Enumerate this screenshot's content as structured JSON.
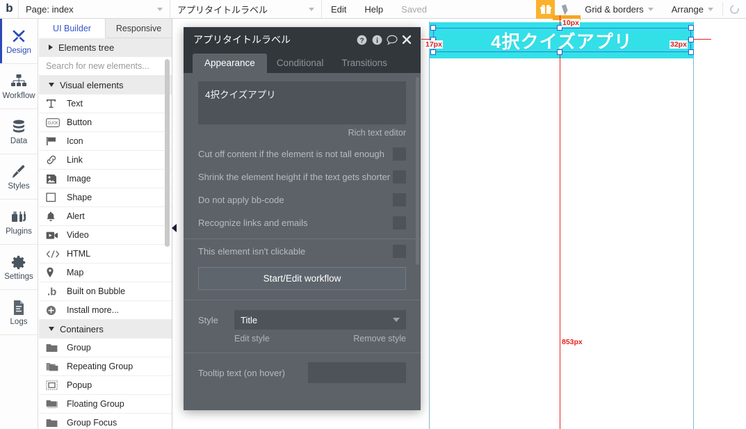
{
  "topbar": {
    "logo": "b",
    "page_selector": {
      "label": "Page: index",
      "icon": "chevron-down-icon"
    },
    "element_selector": {
      "label": "アプリタイトルラベル",
      "icon": "chevron-down-icon"
    },
    "edit": "Edit",
    "help": "Help",
    "saved": "Saved",
    "gift_icon": "gift-icon",
    "cursor_icon": "cursor-arrow-icon",
    "grid_borders": "Grid & borders",
    "arrange": "Arrange",
    "refresh_icon": "refresh-icon"
  },
  "rail": {
    "items": [
      {
        "label": "Design",
        "icon": "design-icon",
        "active": true
      },
      {
        "label": "Workflow",
        "icon": "workflow-icon",
        "active": false
      },
      {
        "label": "Data",
        "icon": "database-icon",
        "active": false
      },
      {
        "label": "Styles",
        "icon": "brush-icon",
        "active": false
      },
      {
        "label": "Plugins",
        "icon": "plugins-icon",
        "active": false
      },
      {
        "label": "Settings",
        "icon": "gear-icon",
        "active": false
      },
      {
        "label": "Logs",
        "icon": "document-icon",
        "active": false
      }
    ]
  },
  "elements_panel": {
    "tabs": [
      {
        "label": "UI Builder",
        "active": true
      },
      {
        "label": "Responsive",
        "active": false
      }
    ],
    "elements_tree": "Elements tree",
    "search_placeholder": "Search for new elements...",
    "sections": [
      {
        "title": "Visual elements",
        "expanded": true,
        "items": [
          {
            "label": "Text",
            "icon": "text-t-icon"
          },
          {
            "label": "Button",
            "icon": "button-click-icon"
          },
          {
            "label": "Icon",
            "icon": "flag-icon"
          },
          {
            "label": "Link",
            "icon": "link-chain-icon"
          },
          {
            "label": "Image",
            "icon": "image-icon"
          },
          {
            "label": "Shape",
            "icon": "square-shape-icon"
          },
          {
            "label": "Alert",
            "icon": "bell-icon"
          },
          {
            "label": "Video",
            "icon": "video-camera-icon"
          },
          {
            "label": "HTML",
            "icon": "code-brackets-icon"
          },
          {
            "label": "Map",
            "icon": "map-pin-icon"
          },
          {
            "label": "Built on Bubble",
            "icon": "bubble-b-icon"
          },
          {
            "label": "Install more...",
            "icon": "plus-circle-icon"
          }
        ]
      },
      {
        "title": "Containers",
        "expanded": true,
        "items": [
          {
            "label": "Group",
            "icon": "folder-icon"
          },
          {
            "label": "Repeating Group",
            "icon": "folders-icon"
          },
          {
            "label": "Popup",
            "icon": "popup-frame-icon"
          },
          {
            "label": "Floating Group",
            "icon": "floating-folder-icon"
          },
          {
            "label": "Group Focus",
            "icon": "folder-icon"
          }
        ]
      }
    ]
  },
  "property_editor": {
    "title": "アプリタイトルラベル",
    "header_icons": [
      "help-question-icon",
      "info-icon",
      "comment-icon",
      "close-icon"
    ],
    "tabs": [
      {
        "label": "Appearance",
        "active": true
      },
      {
        "label": "Conditional",
        "active": false
      },
      {
        "label": "Transitions",
        "active": false
      }
    ],
    "rich_text_value": "4択クイズアプリ",
    "rich_text_link": "Rich text editor",
    "checkboxes": [
      {
        "label": "Cut off content if the element is not tall enough",
        "checked": false
      },
      {
        "label": "Shrink the element height if the text gets shorter",
        "checked": false
      },
      {
        "label": "Do not apply bb-code",
        "checked": false
      },
      {
        "label": "Recognize links and emails",
        "checked": false
      }
    ],
    "clickable_row": {
      "label": "This element isn't clickable",
      "checked": false
    },
    "workflow_button": "Start/Edit workflow",
    "style_label": "Style",
    "style_value": "Title",
    "edit_style": "Edit style",
    "remove_style": "Remove style",
    "tooltip_label": "Tooltip text (on hover)",
    "tooltip_value": ""
  },
  "canvas": {
    "element_text": "4択クイズアプリ",
    "element_color": "#33e0e8",
    "measurements": [
      {
        "value": "10px",
        "position": "top"
      },
      {
        "value": "17px",
        "position": "left"
      },
      {
        "value": "32px",
        "position": "right"
      },
      {
        "value": "853px",
        "position": "center"
      }
    ]
  }
}
